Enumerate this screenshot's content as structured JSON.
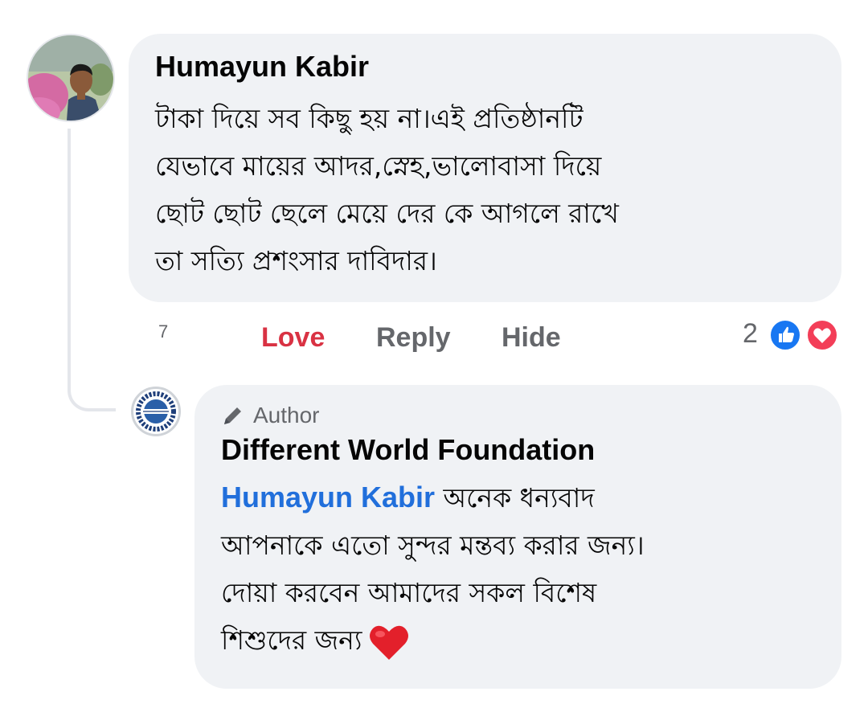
{
  "comment": {
    "author": "Humayun Kabir",
    "text": "টাকা দিয়ে সব কিছু হয় না।এই প্রতিষ্ঠানটি\nযেভাবে  মায়ের  আদর,স্নেহ,ভালোবাসা দিয়ে\nছোট ছোট  ছেলে মেয়ে দের কে আগলে  রাখে\nতা সত্যি  প্রশংসার দাবিদার।",
    "timestamp": "7",
    "actions": {
      "love": "Love",
      "reply": "Reply",
      "hide": "Hide"
    },
    "reactions": {
      "count": "2",
      "icons": [
        "like-icon",
        "love-icon"
      ]
    }
  },
  "reply": {
    "badge": "Author",
    "author": "Different World Foundation",
    "mention": "Humayun Kabir",
    "text_lines": [
      "অনেক ধন্যবাদ",
      "আপনাকে এতো সুন্দর মন্তব্য করার জন্য।",
      "দোয়া করবেন আমাদের সকল বিশেষ",
      "শিশুদের জন্য"
    ],
    "emoji": "heart-emoji"
  },
  "colors": {
    "bubble": "#f0f2f5",
    "love": "#d93243",
    "mention": "#216fdb",
    "secondary_text": "#65676b",
    "like_blue": "#1877f2",
    "love_red": "#f33e58"
  }
}
